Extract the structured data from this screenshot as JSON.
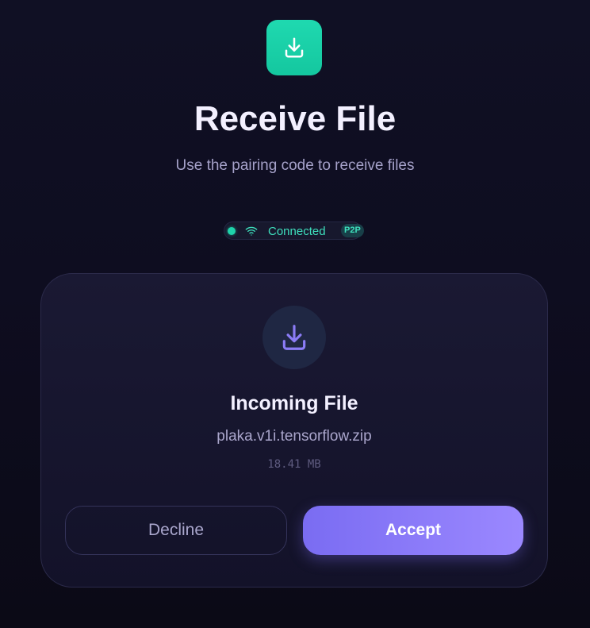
{
  "header": {
    "icon": "download-icon",
    "accent_color": "#1fd9b0",
    "title": "Receive File",
    "subtitle": "Use the pairing code to receive files"
  },
  "status": {
    "dot_color": "#1fd3ab",
    "icon": "wifi-icon",
    "text": "Connected",
    "badge": "P2P"
  },
  "incoming": {
    "icon": "download-icon",
    "icon_color": "#8b7cf6",
    "title": "Incoming File",
    "file_name": "plaka.v1i.tensorflow.zip",
    "file_size": "18.41 MB"
  },
  "actions": {
    "decline_label": "Decline",
    "accept_label": "Accept",
    "accept_color": "#8b7cf6"
  }
}
